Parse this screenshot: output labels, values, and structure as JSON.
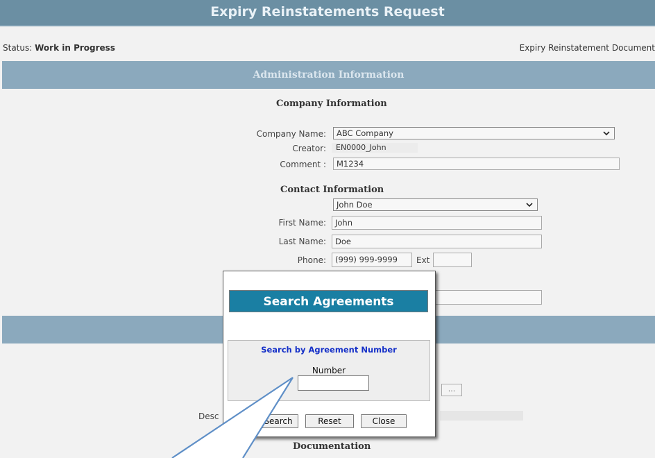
{
  "page": {
    "title": "Expiry Reinstatements Request",
    "status_label": "Status:",
    "status_value": "Work in Progress",
    "status_right": "Expiry Reinstatement Document"
  },
  "admin": {
    "header": "Administration Information",
    "company_heading": "Company Information",
    "company_name_label": "Company Name:",
    "company_name_value": "ABC Company",
    "creator_label": "Creator:",
    "creator_value": "EN0000_John",
    "comment_label": "Comment :",
    "comment_value": "M1234",
    "contact_heading": "Contact Information",
    "contact_select_value": "John Doe",
    "first_name_label": "First Name:",
    "first_name_value": "John",
    "last_name_label": "Last Name:",
    "last_name_value": "Doe",
    "phone_label": "Phone:",
    "phone_value": "(999) 999-9999",
    "ext_label": "Ext"
  },
  "lower": {
    "desc_label_partial": "Desc",
    "ellipsis": "...",
    "documentation_heading": "Documentation"
  },
  "dialog": {
    "title": "Search Agreements",
    "box_heading": "Search by Agreement Number",
    "number_label": "Number",
    "number_value": "",
    "search_button": "Search",
    "reset_button": "Reset",
    "close_button": "Close"
  },
  "icons": {
    "dropdown": "chevron-down-icon",
    "callout": "callout-pointer"
  },
  "colors": {
    "title_bar": "#6b8fa3",
    "section_bar": "#8ba9bd",
    "dialog_title": "#1a7fa3",
    "box_heading": "#1530c8",
    "callout": "#6e98c9"
  }
}
